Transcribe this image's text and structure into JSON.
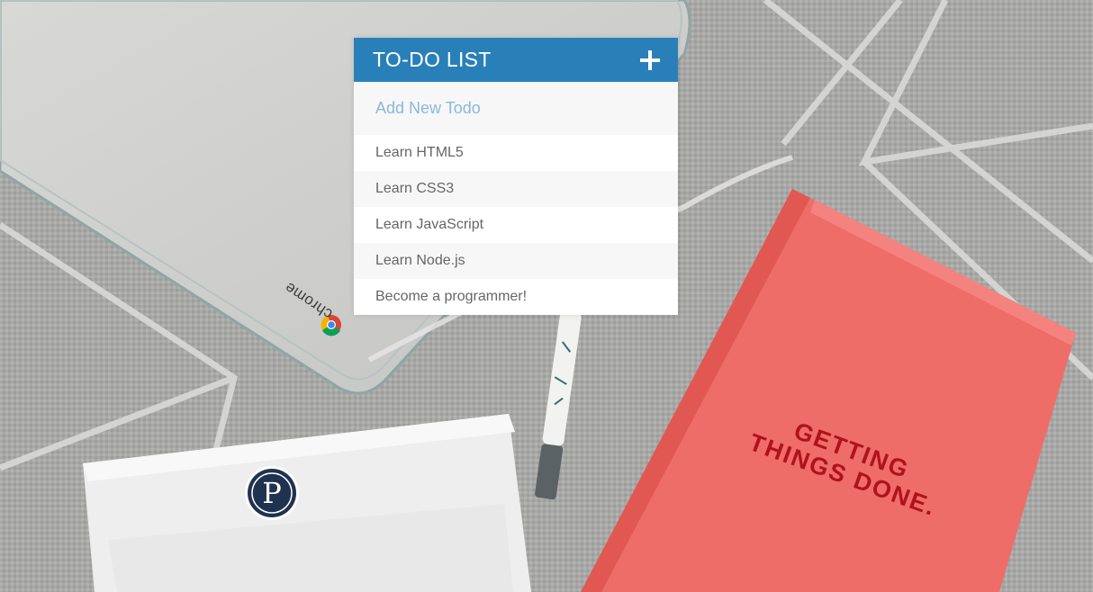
{
  "todo": {
    "title": "TO-DO LIST",
    "add_icon": "plus-icon",
    "input": {
      "value": "",
      "placeholder": "Add New Todo"
    },
    "items": [
      {
        "label": "Learn HTML5"
      },
      {
        "label": "Learn CSS3"
      },
      {
        "label": "Learn JavaScript"
      },
      {
        "label": "Learn Node.js"
      },
      {
        "label": "Become a programmer!"
      }
    ]
  },
  "background": {
    "laptop_brand": "chrome",
    "notebook_text": [
      "GETTING",
      "THINGS DONE."
    ],
    "sticker_letter": "P"
  },
  "colors": {
    "header": "#2980b9",
    "placeholder": "#8ab8dc",
    "item_text": "#666666",
    "notebook": "#ef6f6c"
  }
}
